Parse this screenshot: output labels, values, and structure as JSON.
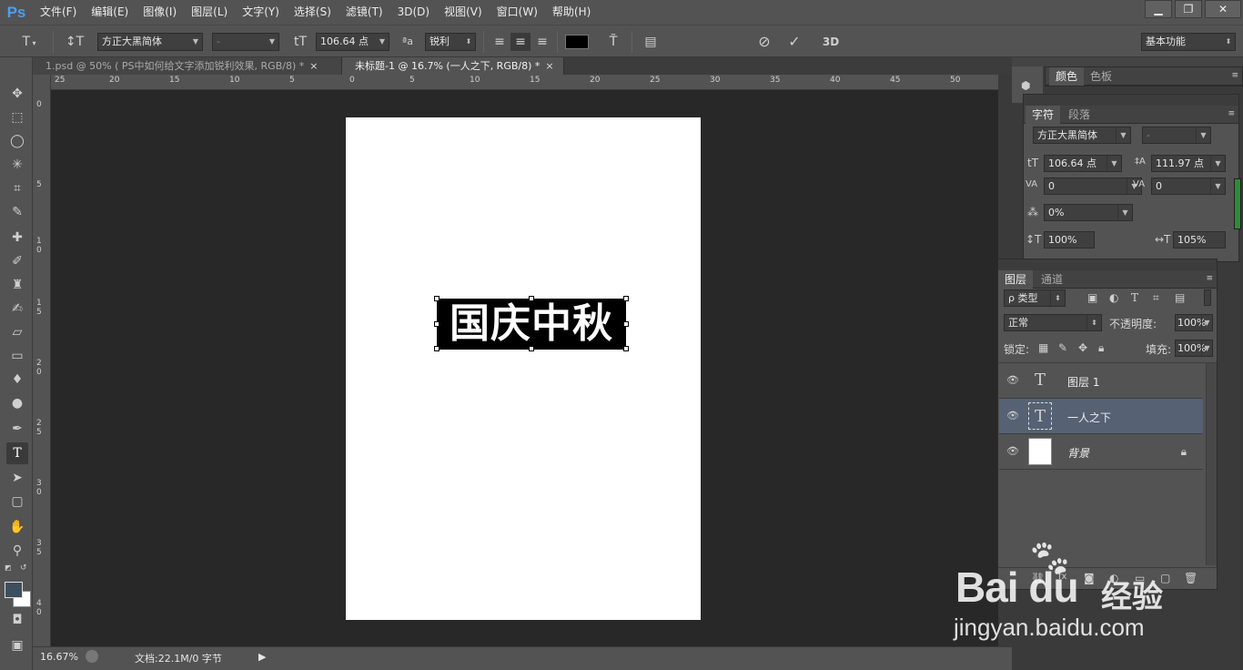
{
  "app": {
    "logo": "Ps",
    "menu": [
      "文件(F)",
      "编辑(E)",
      "图像(I)",
      "图层(L)",
      "文字(Y)",
      "选择(S)",
      "滤镜(T)",
      "3D(D)",
      "视图(V)",
      "窗口(W)",
      "帮助(H)"
    ],
    "window_controls": [
      "minimize",
      "restore",
      "close"
    ]
  },
  "options": {
    "tool_icon": "T",
    "orient_icon": "↕T",
    "font_family": "方正大黑简体",
    "font_style": "-",
    "size_icon": "tT",
    "font_size": "106.64 点",
    "aa_icon": "ªa",
    "anti_alias": "锐利",
    "align": [
      "align-left",
      "align-center",
      "align-right"
    ],
    "color": "#000000",
    "warp_icon": "T̃",
    "panel_toggle_icon": "▤",
    "cancel_icon": "⊘",
    "commit_icon": "✓",
    "three_d": "3D",
    "workspace": "基本功能"
  },
  "tabs": [
    {
      "label": "1.psd @ 50% ( PS中如何给文字添加锐利效果, RGB/8) *",
      "close": "×"
    },
    {
      "label": "未标题-1 @ 16.7% (一人之下, RGB/8) *",
      "close": "×"
    }
  ],
  "ruler": {
    "top": [
      "25",
      "20",
      "15",
      "10",
      "5",
      "0",
      "5",
      "10",
      "15",
      "20",
      "25",
      "30",
      "35",
      "40",
      "45",
      "50"
    ],
    "left": [
      "0",
      "5",
      "1 0",
      "1 5",
      "2 0",
      "2 5",
      "3 0",
      "3 5",
      "4 0"
    ]
  },
  "canvas": {
    "text": "国庆中秋"
  },
  "status": {
    "zoom": "16.67%",
    "doc": "文档:22.1M/0 字节",
    "arrow": "▶"
  },
  "color_panel": {
    "tabs": [
      "颜色",
      "色板"
    ]
  },
  "char_panel": {
    "tabs": [
      "字符",
      "段落"
    ],
    "font_family": "方正大黑简体",
    "font_style": "-",
    "size": "106.64 点",
    "leading": "111.97 点",
    "kerning": "0",
    "tracking": "0",
    "scale_pct": "0%",
    "vscale": "100%",
    "hscale": "105%",
    "size_icon": "tT",
    "leading_icon": "‡A",
    "kern_icon": "VA",
    "track_icon": "VA",
    "scale_icon": "⁂",
    "vscale_icon": "↕T",
    "hscale_icon": "↔T"
  },
  "layers_panel": {
    "tabs": [
      "图层",
      "通道"
    ],
    "filter": "ρ 类型",
    "blend": "正常",
    "opacity_label": "不透明度:",
    "opacity": "100%",
    "lock_label": "锁定:",
    "fill_label": "填充:",
    "fill": "100%",
    "layers": [
      {
        "name": "图层 1",
        "kind": "type",
        "selected": false
      },
      {
        "name": "一人之下",
        "kind": "type",
        "selected": true
      },
      {
        "name": "背景",
        "kind": "image",
        "selected": false
      }
    ]
  },
  "watermark": {
    "brand": "Bai du",
    "jingyan": "经验",
    "url": "jingyan.baidu.com"
  }
}
